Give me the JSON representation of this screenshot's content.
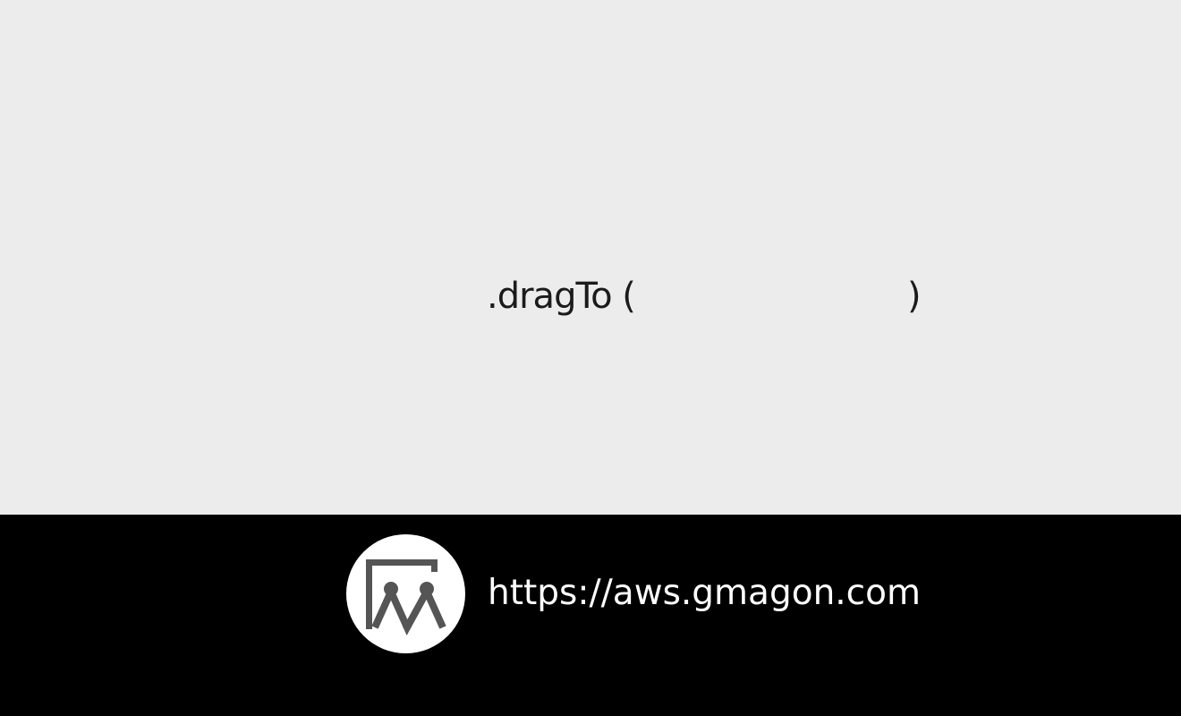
{
  "code": {
    "method_text": ".dragTo (",
    "close_paren": ")"
  },
  "footer": {
    "logo_icon": "gmagon-logo-icon",
    "url": "https://aws.gmagon.com"
  },
  "colors": {
    "background": "#ececec",
    "footer_background": "#000000",
    "code_text": "#1b1b1b",
    "footer_text": "#ffffff",
    "logo_mark": "#555555"
  }
}
